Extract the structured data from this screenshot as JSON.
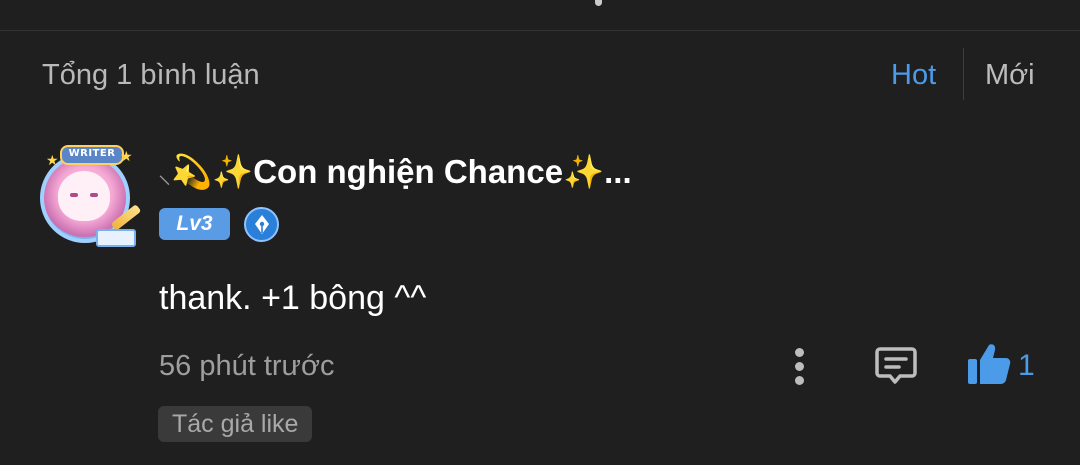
{
  "header": {
    "total_label": "Tổng 1 bình luận",
    "sort_hot": "Hot",
    "sort_new": "Mới",
    "accent_color": "#4c9be8"
  },
  "comment": {
    "username_feather": "⸜",
    "username_comet": "💫",
    "username_sparkle_left": "✨",
    "username_text": "Con nghiện Chance",
    "username_sparkle_right": "✨",
    "username_ellipsis": "...",
    "avatar_frame_text": "WRITER",
    "level": "Lv3",
    "text": "thank. +1 bông ^^",
    "time": "56 phút trước",
    "like_count": "1",
    "author_like": "Tác giả like",
    "icons": {
      "more": "more-vertical-icon",
      "reply": "reply-comment-icon",
      "like": "thumbs-up-icon",
      "role": "pen-nib-badge-icon"
    }
  }
}
